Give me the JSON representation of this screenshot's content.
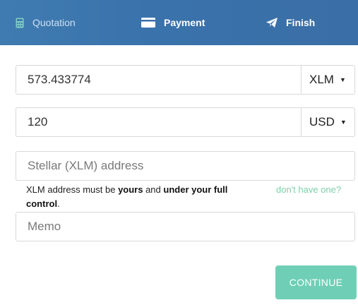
{
  "steps": [
    {
      "label": "Quotation",
      "icon": "calculator-icon",
      "state": "done"
    },
    {
      "label": "Payment",
      "icon": "credit-card-icon",
      "state": "active"
    },
    {
      "label": "Finish",
      "icon": "paper-plane-icon",
      "state": "pending"
    }
  ],
  "form": {
    "crypto_amount": {
      "value": "573.433774",
      "currency": "XLM"
    },
    "fiat_amount": {
      "value": "120",
      "currency": "USD"
    },
    "address": {
      "placeholder": "Stellar (XLM) address"
    },
    "hint": {
      "prefix": "XLM address must be ",
      "bold1": "yours",
      "middle": " and ",
      "bold2": "under your full control",
      "suffix": "."
    },
    "help_link": "don't have one?",
    "memo": {
      "placeholder": "Memo"
    }
  },
  "continue_label": "CONTINUE",
  "colors": {
    "header": "#3a72ab",
    "button": "#6fcfb6",
    "link": "#7fcfa9",
    "done_step_icon": "#7fd0c0"
  }
}
